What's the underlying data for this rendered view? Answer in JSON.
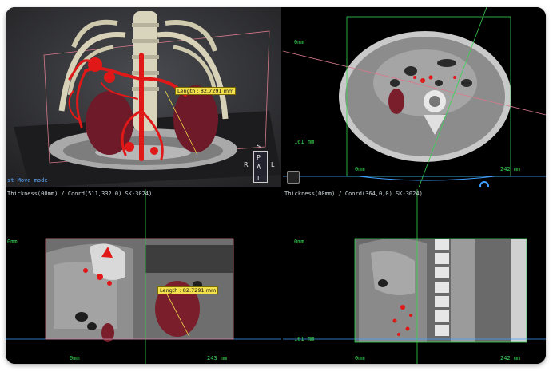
{
  "viewer": {
    "volume_view": {
      "mode_label": "st Move mode",
      "measurement": "Length : 82.7291 mm",
      "orientation": {
        "top": "S",
        "upper": "P",
        "mid": "A",
        "bottom": "I",
        "left": "R",
        "right": "L"
      }
    },
    "axial_view": {
      "top_scale": "0mm",
      "left_scale": "161 mm",
      "bottom_start": "0mm",
      "bottom_end": "242 mm"
    },
    "coronal_view": {
      "header": "Thickness(00mm) / Coord(511,332,0) SK-3024)",
      "left_mark": "0mm",
      "measurement": "Length : 82.7291 mm",
      "bottom_start": "0mm",
      "bottom_end": "243 mm"
    },
    "sagittal_view": {
      "header": "Thickness(00mm) / Coord(364,0,0) SK-3024)",
      "top_mark": "0mm",
      "left_scale": "161 mm",
      "bottom_start": "0mm",
      "bottom_end": "242 mm"
    },
    "colors": {
      "accent_green": "#39d353",
      "accent_blue": "#3fa1ff",
      "vessel_red": "#e01818",
      "kidney": "#7a1e2c",
      "badge": "#f2e04c"
    }
  }
}
